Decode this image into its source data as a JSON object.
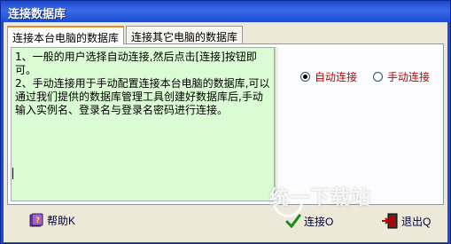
{
  "window": {
    "title": "连接数据库"
  },
  "tabs": [
    {
      "label": "连接本台电脑的数据库"
    },
    {
      "label": "连接其它电脑的数据库"
    }
  ],
  "instructions": "1、一般的用户选择自动连接,然后点击[连接]按钮即可。\n2、手动连接用于手动配置连接本台电脑的数据库,可以通过我们提供的数据库管理工具创建好数据库后,手动输入实例名、登录名与登录名密码进行连接。",
  "mode": {
    "options": [
      {
        "label": "自动连接",
        "selected": true
      },
      {
        "label": "手动连接",
        "selected": false
      }
    ]
  },
  "buttons": {
    "help": "帮助K",
    "connect": "连接O",
    "exit": "退出Q"
  },
  "watermark": {
    "text": "统一下载站"
  },
  "colors": {
    "titlebar": "#2456dc",
    "memo_bg": "#dbfbd4",
    "radio_text": "#c00000",
    "tab_highlight": "#e68b2c"
  }
}
